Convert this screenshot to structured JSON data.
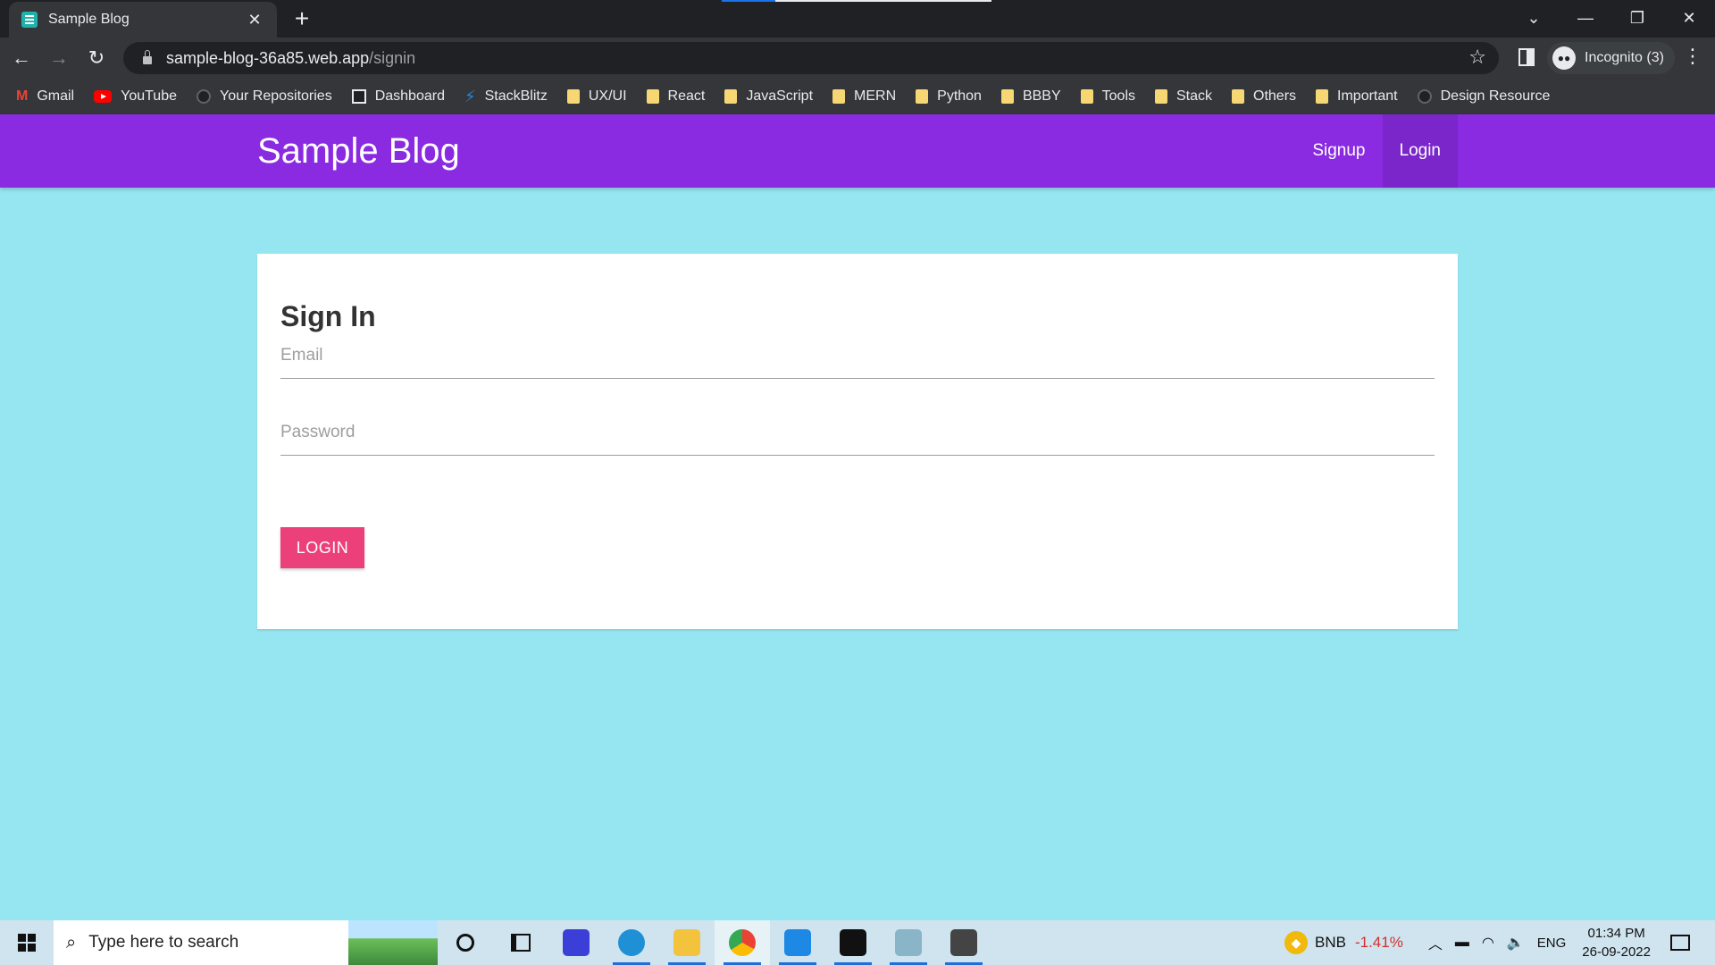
{
  "browser": {
    "tab_title": "Sample Blog",
    "tab_close": "✕",
    "new_tab": "+",
    "url_host": "sample-blog-36a85.web.app",
    "url_path": "/signin",
    "incognito_label": "Incognito (3)",
    "window_controls": [
      "⌄",
      "—",
      "❐",
      "✕"
    ],
    "bookmarks": [
      {
        "label": "Gmail",
        "icon": "gmail-icon"
      },
      {
        "label": "YouTube",
        "icon": "youtube-icon"
      },
      {
        "label": "Your Repositories",
        "icon": "github-icon"
      },
      {
        "label": "Dashboard",
        "icon": "dashboard-icon"
      },
      {
        "label": "StackBlitz",
        "icon": "stackblitz-icon"
      },
      {
        "label": "UX/UI",
        "icon": "folder-icon"
      },
      {
        "label": "React",
        "icon": "folder-icon"
      },
      {
        "label": "JavaScript",
        "icon": "folder-icon"
      },
      {
        "label": "MERN",
        "icon": "folder-icon"
      },
      {
        "label": "Python",
        "icon": "folder-icon"
      },
      {
        "label": "BBBY",
        "icon": "folder-icon"
      },
      {
        "label": "Tools",
        "icon": "folder-icon"
      },
      {
        "label": "Stack",
        "icon": "folder-icon"
      },
      {
        "label": "Others",
        "icon": "folder-icon"
      },
      {
        "label": "Important",
        "icon": "folder-icon"
      },
      {
        "label": "Design Resource",
        "icon": "github-icon"
      }
    ]
  },
  "app": {
    "brand": "Sample Blog",
    "nav": {
      "signup": "Signup",
      "login": "Login"
    },
    "colors": {
      "navbar": "#8a2be2",
      "background": "#96e6f1",
      "button": "#ec407a"
    }
  },
  "signin": {
    "title": "Sign In",
    "email_placeholder": "Email",
    "password_placeholder": "Password",
    "email_value": "",
    "password_value": "",
    "login_button": "LOGIN"
  },
  "taskbar": {
    "search_placeholder": "Type here to search",
    "ticker": "BNB",
    "ticker_change": "-1.41%",
    "language": "ENG",
    "time": "01:34 PM",
    "date": "26-09-2022"
  }
}
